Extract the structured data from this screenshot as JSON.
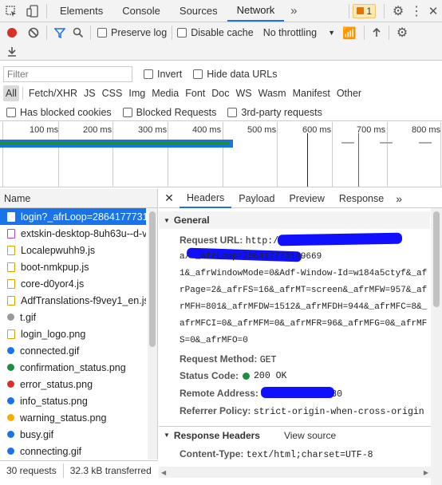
{
  "top_tabs": [
    "Elements",
    "Console",
    "Sources",
    "Network"
  ],
  "more_tabs": "»",
  "issue_count": "1",
  "toolbar": {
    "preserve_log": "Preserve log",
    "disable_cache": "Disable cache",
    "throttling": "No throttling"
  },
  "filter": {
    "placeholder": "Filter",
    "invert": "Invert",
    "hide_data_urls": "Hide data URLs"
  },
  "types": [
    "All",
    "Fetch/XHR",
    "JS",
    "CSS",
    "Img",
    "Media",
    "Font",
    "Doc",
    "WS",
    "Wasm",
    "Manifest",
    "Other"
  ],
  "blocked": {
    "cookies": "Has blocked cookies",
    "requests": "Blocked Requests",
    "third_party": "3rd-party requests"
  },
  "timeline": [
    "100 ms",
    "200 ms",
    "300 ms",
    "400 ms",
    "500 ms",
    "600 ms",
    "700 ms",
    "800 ms"
  ],
  "name_header": "Name",
  "files": [
    {
      "name": "login?_afrLoop=28641777314",
      "color": "#1a73e8",
      "kind": "doc"
    },
    {
      "name": "extskin-desktop-8uh63u--d-v",
      "color": "#a142f4",
      "kind": "css"
    },
    {
      "name": "Localepwuhh9.js",
      "color": "#e5a000",
      "kind": "js"
    },
    {
      "name": "boot-nmkpup.js",
      "color": "#e5a000",
      "kind": "js"
    },
    {
      "name": "core-d0yor4.js",
      "color": "#e5a000",
      "kind": "js"
    },
    {
      "name": "AdfTranslations-f9vey1_en.js?",
      "color": "#e5a000",
      "kind": "js"
    },
    {
      "name": "t.gif",
      "color": "#999",
      "kind": "img"
    },
    {
      "name": "login_logo.png",
      "color": "#e5a000",
      "kind": "js"
    },
    {
      "name": "connected.gif",
      "color": "#1a73e8",
      "kind": "img"
    },
    {
      "name": "confirmation_status.png",
      "color": "#1e8e3e",
      "kind": "img"
    },
    {
      "name": "error_status.png",
      "color": "#d93025",
      "kind": "img"
    },
    {
      "name": "info_status.png",
      "color": "#1a73e8",
      "kind": "img"
    },
    {
      "name": "warning_status.png",
      "color": "#f9ab00",
      "kind": "img"
    },
    {
      "name": "busy.gif",
      "color": "#1a73e8",
      "kind": "img"
    },
    {
      "name": "connecting.gif",
      "color": "#1a73e8",
      "kind": "img"
    }
  ],
  "detail_tabs": [
    "Headers",
    "Payload",
    "Preview",
    "Response"
  ],
  "general": {
    "title": "General",
    "request_url_label": "Request URL:",
    "request_url_lines": [
      "http://",
      "a/                   _afrLoop=286417773149669",
      "1&_afrWindowMode=0&Adf-Window-Id=w184a5ctyf&_af",
      "rPage=2&_afrFS=16&_afrMT=screen&_afrMFW=957&_af",
      "rMFH=801&_afrMFDW=1512&_afrMFDH=944&_afrMFC=8&_",
      "afrMFCI=0&_afrMFM=0&_afrMFR=96&_afrMFG=0&_afrMF",
      "S=0&_afrMFO=0"
    ],
    "method_label": "Request Method:",
    "method": "GET",
    "status_label": "Status Code:",
    "status": "200 OK",
    "remote_label": "Remote Address:",
    "remote": "80",
    "referrer_label": "Referrer Policy:",
    "referrer": "strict-origin-when-cross-origin"
  },
  "response_headers": {
    "title": "Response Headers",
    "view_source": "View source",
    "ct_label": "Content-Type:",
    "ct": "text/html;charset=UTF-8"
  },
  "status_bar": {
    "requests": "30 requests",
    "transferred": "32.3 kB transferred"
  }
}
